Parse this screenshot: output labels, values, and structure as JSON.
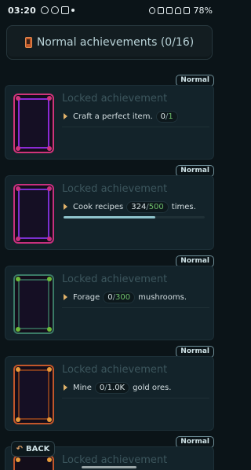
{
  "status_bar": {
    "time": "03:20",
    "notifications": [
      "dot-icon",
      "instagram-icon",
      "gmail-icon",
      "dot"
    ],
    "battery": "78%"
  },
  "header": {
    "title": "Normal achievements (0/16)"
  },
  "achievements": [
    {
      "badge": "Normal",
      "title": "Locked achievement",
      "verb": "Craft a perfect item.",
      "current": "0",
      "total": "1",
      "suffix": "",
      "progress": 0,
      "color": "#d0347a",
      "accent": "#8b2ad4"
    },
    {
      "badge": "Normal",
      "title": "Locked achievement",
      "verb": "Cook recipes",
      "current": "324",
      "total": "500",
      "suffix": "times.",
      "progress": 0.648,
      "color": "#c8307e",
      "accent": "#7a30cf"
    },
    {
      "badge": "Normal",
      "title": "Locked achievement",
      "verb": "Forage",
      "current": "0",
      "total": "300",
      "suffix": "mushrooms.",
      "progress": 0,
      "color": "#3a7a66",
      "accent": "#6dbb3a"
    },
    {
      "badge": "Normal",
      "title": "Locked achievement",
      "verb": "Mine",
      "current": "0",
      "total": "1.0K",
      "suffix": "gold ores.",
      "progress": 0,
      "color": "#c2562a",
      "accent": "#e89a3a"
    },
    {
      "badge": "Normal",
      "title": "Locked achievement",
      "color": "#c2562a",
      "accent": "#e89a3a"
    }
  ],
  "back_button": {
    "label": "BACK"
  }
}
